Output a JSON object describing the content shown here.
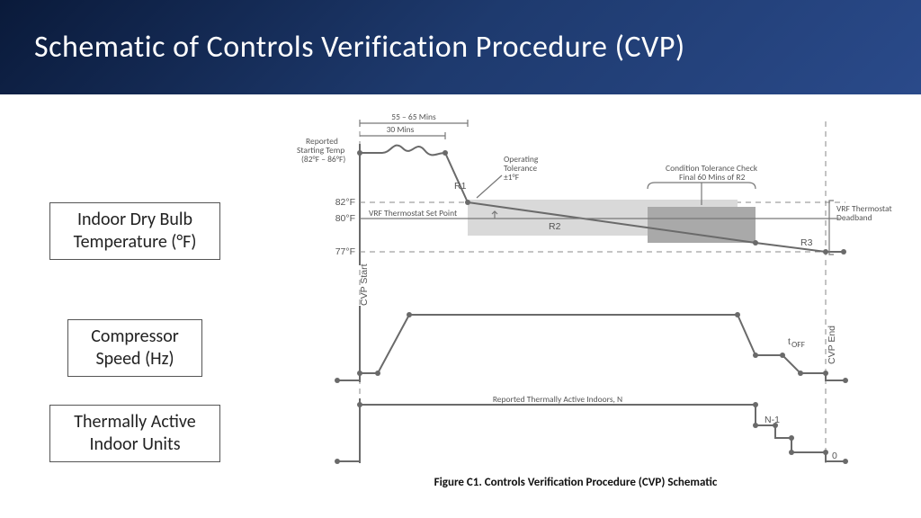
{
  "title": "Schematic of Controls Verification Procedure (CVP)",
  "sideLabels": {
    "temp": "Indoor Dry Bulb Temperature (°F)",
    "comp": "Compressor Speed (Hz)",
    "units": "Thermally Active Indoor Units"
  },
  "annotations": {
    "time55_65": "55 – 65 Mins",
    "time30": "30 Mins",
    "reportedStart": "Reported Starting Temp (82°F – 86°F)",
    "y82": "82°F",
    "y80": "80°F",
    "y77": "77°F",
    "r1": "R1",
    "r2": "R2",
    "r3": "R3",
    "opTol": "Operating Tolerance ±1°F",
    "setpoint": "VRF Thermostat Set Point",
    "deadband": "VRF Thermostat Deadband",
    "condCheck": "Condition Tolerance Check Final 60 Mins of R2",
    "cvpStart": "CVP Start",
    "cvpEnd": "CVP End",
    "tOff": "t",
    "tOffSub": "OFF",
    "reportedN": "Reported Thermally Active Indoors, N",
    "n1": "N-1",
    "zero": "0"
  },
  "caption": "Figure C1. Controls Verification Procedure (CVP) Schematic",
  "chart_data": {
    "type": "diagram",
    "plots": [
      {
        "name": "Indoor Dry Bulb Temperature (°F)",
        "reference_lines": [
          82,
          80,
          77
        ],
        "start_range": [
          82,
          86
        ],
        "regions": [
          "R1",
          "R2",
          "R3"
        ],
        "timings": {
          "phase1": "30 Mins",
          "phase1plus": "55 – 65 Mins"
        },
        "operating_tolerance": "±1°F",
        "condition_check": "Final 60 Mins of R2"
      },
      {
        "name": "Compressor Speed (Hz)",
        "profile": "ramp up → hold high → step down → off (t_OFF)"
      },
      {
        "name": "Thermally Active Indoor Units",
        "levels": [
          "N",
          "N-1",
          0
        ]
      }
    ],
    "markers": [
      "CVP Start",
      "CVP End"
    ]
  }
}
